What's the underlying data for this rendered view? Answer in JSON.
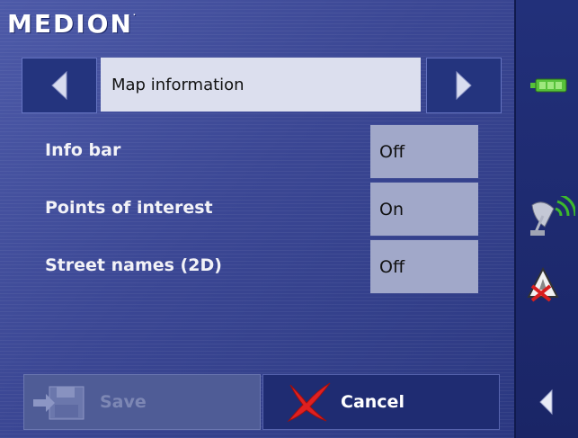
{
  "brand": {
    "logo_text": "MEDION",
    "mark": "."
  },
  "header": {
    "title": "Map information",
    "prev_icon": "arrow-left-icon",
    "next_icon": "arrow-right-icon"
  },
  "settings": [
    {
      "label": "Info bar",
      "value": "Off"
    },
    {
      "label": "Points of interest",
      "value": "On"
    },
    {
      "label": "Street names (2D)",
      "value": "Off"
    }
  ],
  "buttons": {
    "save_label": "Save",
    "save_enabled": false,
    "cancel_label": "Cancel"
  },
  "sidebar": {
    "icons": [
      "battery-icon",
      "gps-satellite-icon",
      "warning-no-signal-icon",
      "back-arrow-icon"
    ]
  },
  "colors": {
    "background": "#3b4794",
    "panel": "#1c2a66",
    "title_box": "#dcdfee",
    "value_box": "#a1a8c9",
    "battery_green": "#57c23a",
    "cancel_red": "#e02020"
  }
}
